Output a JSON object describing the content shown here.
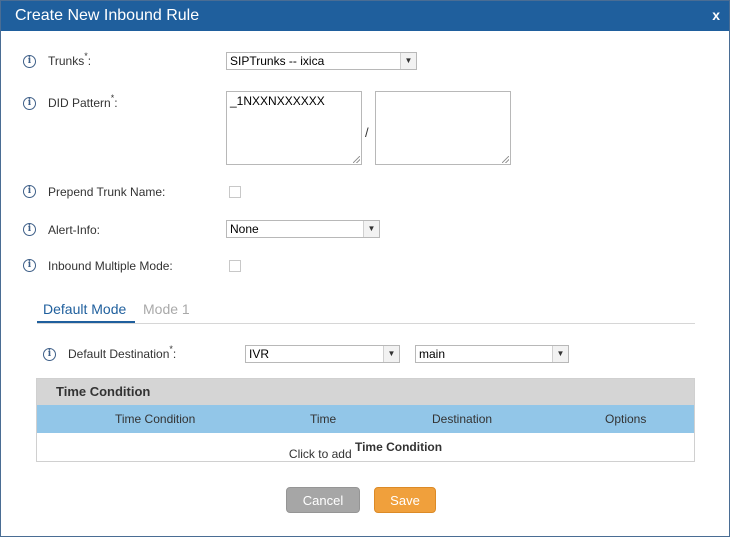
{
  "dialog": {
    "title": "Create New Inbound Rule",
    "close": "x"
  },
  "fields": {
    "trunks": {
      "label": "Trunks",
      "required": "*",
      "colon": ":",
      "value": "SIPTrunks -- ixica"
    },
    "did_pattern": {
      "label": "DID Pattern",
      "required": "*",
      "colon": ":",
      "value": "_1NXXNXXXXXX",
      "separator": "/",
      "value2": ""
    },
    "prepend_trunk_name": {
      "label": "Prepend Trunk Name:",
      "checked": false
    },
    "alert_info": {
      "label": "Alert-Info:",
      "value": "None"
    },
    "inbound_multiple_mode": {
      "label": "Inbound Multiple Mode:",
      "checked": false
    }
  },
  "tabs": [
    {
      "label": "Default Mode",
      "active": true
    },
    {
      "label": "Mode 1",
      "active": false
    }
  ],
  "default_destination": {
    "label": "Default Destination",
    "required": "*",
    "colon": ":",
    "type": "IVR",
    "target": "main"
  },
  "time_condition": {
    "title": "Time Condition",
    "columns": [
      "Time Condition",
      "Time",
      "Destination",
      "Options"
    ],
    "add_prefix": "Click to add ",
    "add_bold": "Time Condition"
  },
  "buttons": {
    "cancel": "Cancel",
    "save": "Save"
  },
  "icons": {
    "info": "info-icon",
    "dropdown": "chevron-down-icon"
  },
  "colors": {
    "title_bar": "#1f5f9d",
    "table_header": "#92c6e8",
    "save": "#f0a03c",
    "cancel": "#a6a6a6"
  }
}
